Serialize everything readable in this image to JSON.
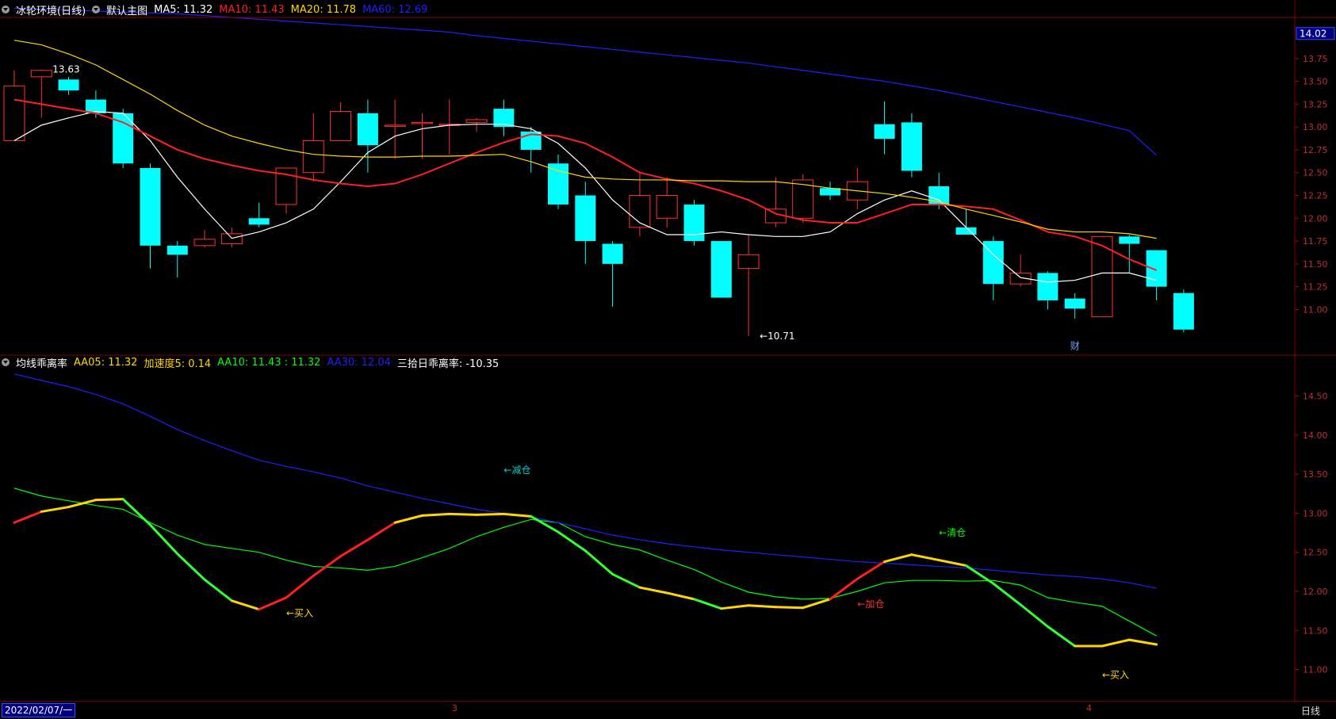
{
  "window": {
    "stock_title": "冰轮环境(日线)",
    "template": "默认主图"
  },
  "main_legend": [
    {
      "label": "MA5: 11.32",
      "color": "#ffffff"
    },
    {
      "label": "MA10: 11.43",
      "color": "#ff2020"
    },
    {
      "label": "MA20: 11.78",
      "color": "#ffd700"
    },
    {
      "label": "MA60: 12.69",
      "color": "#2020ff"
    }
  ],
  "indicator_legend": {
    "name": "均线乖离率",
    "items": [
      {
        "label": "AA05: 11.32",
        "color": "#ffd700"
      },
      {
        "label": "加速度5: 0.14",
        "color": "#ffd700"
      },
      {
        "label": "AA10: 11.43 : 11.32",
        "color": "#00ff00"
      },
      {
        "label": "AA30: 12.04",
        "color": "#2020ff"
      },
      {
        "label": "三拾日乖离率: -10.35",
        "color": "#ffffff"
      }
    ]
  },
  "status": {
    "date": "2022/02/07/一",
    "period": "日线",
    "month_ticks": [
      "3",
      "4"
    ]
  },
  "chart_data": [
    {
      "type": "candlestick",
      "price_axis_ticks": [
        "14.02",
        "13.75",
        "13.50",
        "13.25",
        "13.00",
        "12.75",
        "12.50",
        "12.25",
        "12.00",
        "11.75",
        "11.50",
        "11.25",
        "11.00"
      ],
      "current_price_label": "14.02",
      "ylim": [
        10.5,
        14.2
      ],
      "candles": [
        {
          "o": 12.85,
          "h": 13.62,
          "l": 12.85,
          "c": 13.45
        },
        {
          "o": 13.55,
          "h": 13.63,
          "l": 13.1,
          "c": 13.62
        },
        {
          "o": 13.52,
          "h": 13.55,
          "l": 13.35,
          "c": 13.4
        },
        {
          "o": 13.3,
          "h": 13.4,
          "l": 13.1,
          "c": 13.15
        },
        {
          "o": 13.15,
          "h": 13.2,
          "l": 12.55,
          "c": 12.6
        },
        {
          "o": 12.55,
          "h": 12.6,
          "l": 11.45,
          "c": 11.7
        },
        {
          "o": 11.7,
          "h": 11.75,
          "l": 11.35,
          "c": 11.6
        },
        {
          "o": 11.7,
          "h": 11.87,
          "l": 11.68,
          "c": 11.77
        },
        {
          "o": 11.72,
          "h": 11.9,
          "l": 11.68,
          "c": 11.83
        },
        {
          "o": 12.0,
          "h": 12.17,
          "l": 11.9,
          "c": 11.93
        },
        {
          "o": 12.15,
          "h": 12.55,
          "l": 12.05,
          "c": 12.55
        },
        {
          "o": 12.5,
          "h": 13.15,
          "l": 12.4,
          "c": 12.85
        },
        {
          "o": 12.85,
          "h": 13.27,
          "l": 12.85,
          "c": 13.17
        },
        {
          "o": 13.15,
          "h": 13.3,
          "l": 12.5,
          "c": 12.8
        },
        {
          "o": 13.02,
          "h": 13.3,
          "l": 12.65,
          "c": 13.02
        },
        {
          "o": 13.05,
          "h": 13.15,
          "l": 12.65,
          "c": 13.05
        },
        {
          "o": 13.03,
          "h": 13.3,
          "l": 12.7,
          "c": 13.03
        },
        {
          "o": 13.05,
          "h": 13.1,
          "l": 12.95,
          "c": 13.08
        },
        {
          "o": 13.2,
          "h": 13.3,
          "l": 12.9,
          "c": 13.0
        },
        {
          "o": 12.95,
          "h": 13.0,
          "l": 12.5,
          "c": 12.75
        },
        {
          "o": 12.6,
          "h": 12.7,
          "l": 12.1,
          "c": 12.15
        },
        {
          "o": 12.25,
          "h": 12.4,
          "l": 11.5,
          "c": 11.75
        },
        {
          "o": 11.72,
          "h": 11.75,
          "l": 11.03,
          "c": 11.5
        },
        {
          "o": 11.9,
          "h": 12.5,
          "l": 11.8,
          "c": 12.25
        },
        {
          "o": 12.0,
          "h": 12.45,
          "l": 11.9,
          "c": 12.25
        },
        {
          "o": 12.15,
          "h": 12.2,
          "l": 11.7,
          "c": 11.75
        },
        {
          "o": 11.75,
          "h": 11.75,
          "l": 11.13,
          "c": 11.13
        },
        {
          "o": 11.45,
          "h": 11.82,
          "l": 10.71,
          "c": 11.6
        },
        {
          "o": 11.95,
          "h": 12.45,
          "l": 11.9,
          "c": 12.1
        },
        {
          "o": 12.0,
          "h": 12.48,
          "l": 11.95,
          "c": 12.42
        },
        {
          "o": 12.33,
          "h": 12.4,
          "l": 12.2,
          "c": 12.25
        },
        {
          "o": 12.2,
          "h": 12.55,
          "l": 12.1,
          "c": 12.4
        },
        {
          "o": 13.03,
          "h": 13.28,
          "l": 12.7,
          "c": 12.87
        },
        {
          "o": 13.05,
          "h": 13.15,
          "l": 12.45,
          "c": 12.52
        },
        {
          "o": 12.35,
          "h": 12.5,
          "l": 12.1,
          "c": 12.15
        },
        {
          "o": 11.9,
          "h": 12.1,
          "l": 11.83,
          "c": 11.82
        },
        {
          "o": 11.75,
          "h": 11.8,
          "l": 11.1,
          "c": 11.28
        },
        {
          "o": 11.28,
          "h": 11.6,
          "l": 11.25,
          "c": 11.4
        },
        {
          "o": 11.4,
          "h": 11.42,
          "l": 11.0,
          "c": 11.1
        },
        {
          "o": 11.12,
          "h": 11.18,
          "l": 10.9,
          "c": 11.01
        },
        {
          "o": 10.92,
          "h": 11.8,
          "l": 10.92,
          "c": 11.8
        },
        {
          "o": 11.8,
          "h": 11.82,
          "l": 11.4,
          "c": 11.72
        },
        {
          "o": 11.65,
          "h": 11.65,
          "l": 11.1,
          "c": 11.25
        },
        {
          "o": 11.18,
          "h": 11.22,
          "l": 10.75,
          "c": 10.78
        }
      ],
      "series": [
        {
          "name": "MA5",
          "color": "#ffffff",
          "values": [
            12.85,
            13.02,
            13.1,
            13.17,
            13.15,
            12.85,
            12.45,
            12.1,
            11.78,
            11.85,
            11.95,
            12.1,
            12.4,
            12.72,
            12.9,
            12.98,
            13.02,
            13.03,
            13.03,
            12.98,
            12.82,
            12.55,
            12.2,
            11.95,
            11.82,
            11.82,
            11.85,
            11.82,
            11.8,
            11.8,
            11.85,
            12.05,
            12.2,
            12.3,
            12.2,
            11.9,
            11.6,
            11.35,
            11.3,
            11.32,
            11.4,
            11.4,
            11.32
          ]
        },
        {
          "name": "MA10",
          "color": "#ff2020",
          "values": [
            13.3,
            13.25,
            13.2,
            13.15,
            13.05,
            12.9,
            12.75,
            12.65,
            12.58,
            12.52,
            12.48,
            12.42,
            12.38,
            12.35,
            12.38,
            12.48,
            12.6,
            12.72,
            12.83,
            12.92,
            12.9,
            12.82,
            12.67,
            12.5,
            12.43,
            12.38,
            12.3,
            12.2,
            12.05,
            11.98,
            11.95,
            11.95,
            12.05,
            12.15,
            12.15,
            12.13,
            12.1,
            11.98,
            11.85,
            11.8,
            11.7,
            11.55,
            11.43
          ]
        },
        {
          "name": "MA20",
          "color": "#ffd700",
          "values": [
            13.95,
            13.9,
            13.8,
            13.68,
            13.52,
            13.36,
            13.18,
            13.02,
            12.9,
            12.82,
            12.75,
            12.7,
            12.68,
            12.67,
            12.67,
            12.68,
            12.68,
            12.69,
            12.7,
            12.62,
            12.52,
            12.45,
            12.43,
            12.42,
            12.42,
            12.41,
            12.41,
            12.4,
            12.4,
            12.37,
            12.33,
            12.3,
            12.27,
            12.23,
            12.18,
            12.1,
            12.03,
            11.96,
            11.88,
            11.85,
            11.85,
            11.83,
            11.78
          ]
        },
        {
          "name": "MA60",
          "color": "#2020ff",
          "values": [
            14.3,
            14.29,
            14.28,
            14.27,
            14.26,
            14.25,
            14.24,
            14.22,
            14.2,
            14.18,
            14.16,
            14.14,
            14.12,
            14.1,
            14.08,
            14.06,
            14.04,
            14.0,
            13.97,
            13.94,
            13.91,
            13.88,
            13.85,
            13.82,
            13.79,
            13.76,
            13.73,
            13.7,
            13.66,
            13.62,
            13.58,
            13.54,
            13.5,
            13.45,
            13.4,
            13.34,
            13.28,
            13.22,
            13.16,
            13.1,
            13.03,
            12.96,
            12.69
          ]
        }
      ],
      "annotations": [
        {
          "text": "13.63",
          "candle": 1,
          "price": 13.63
        },
        {
          "text": "←10.71",
          "candle": 27,
          "price": 10.71
        },
        {
          "text": "财",
          "candle": 39,
          "price": 10.6
        }
      ]
    },
    {
      "type": "line",
      "price_axis_ticks": [
        "14.50",
        "14.00",
        "13.50",
        "13.00",
        "12.50",
        "12.00",
        "11.50",
        "11.00"
      ],
      "ylim": [
        10.6,
        14.8
      ],
      "series": [
        {
          "name": "AA05",
          "values": [
            12.88,
            13.02,
            13.08,
            13.17,
            13.18,
            12.85,
            12.48,
            12.15,
            11.88,
            11.77,
            11.92,
            12.2,
            12.45,
            12.66,
            12.88,
            12.97,
            12.99,
            12.98,
            12.99,
            12.96,
            12.76,
            12.52,
            12.22,
            12.05,
            11.98,
            11.9,
            11.78,
            11.82,
            11.8,
            11.79,
            11.9,
            12.16,
            12.38,
            12.47,
            12.4,
            12.33,
            12.1,
            11.83,
            11.55,
            11.3,
            11.3,
            11.38,
            11.32
          ]
        },
        {
          "name": "AA10",
          "color": "#00ff00",
          "values": [
            13.32,
            13.22,
            13.16,
            13.1,
            13.05,
            12.88,
            12.72,
            12.6,
            12.55,
            12.5,
            12.4,
            12.32,
            12.3,
            12.27,
            12.32,
            12.43,
            12.55,
            12.7,
            12.82,
            12.92,
            12.88,
            12.7,
            12.6,
            12.53,
            12.4,
            12.28,
            12.12,
            11.99,
            11.93,
            11.9,
            11.91,
            12.0,
            12.11,
            12.14,
            12.14,
            12.13,
            12.14,
            12.08,
            11.92,
            11.86,
            11.81,
            11.62,
            11.43
          ]
        },
        {
          "name": "AA30",
          "color": "#2020ff",
          "values": [
            14.78,
            14.7,
            14.62,
            14.52,
            14.4,
            14.24,
            14.07,
            13.93,
            13.8,
            13.68,
            13.6,
            13.53,
            13.45,
            13.35,
            13.27,
            13.19,
            13.12,
            13.05,
            13.0,
            12.95,
            12.88,
            12.8,
            12.72,
            12.66,
            12.61,
            12.57,
            12.53,
            12.5,
            12.47,
            12.44,
            12.41,
            12.38,
            12.36,
            12.34,
            12.32,
            12.3,
            12.27,
            12.24,
            12.21,
            12.19,
            12.16,
            12.11,
            12.04
          ]
        }
      ],
      "annotations": [
        {
          "text": "←买入",
          "color": "#ffd700",
          "index": 10,
          "value": 11.72
        },
        {
          "text": "←减仓",
          "color": "#00d0d0",
          "index": 18,
          "value": 13.55
        },
        {
          "text": "←加仓",
          "color": "#ff3030",
          "index": 31,
          "value": 11.84
        },
        {
          "text": "←清仓",
          "color": "#00ff00",
          "index": 34,
          "value": 12.75
        },
        {
          "text": "←买入",
          "color": "#ffd700",
          "index": 40,
          "value": 10.93
        }
      ]
    }
  ]
}
